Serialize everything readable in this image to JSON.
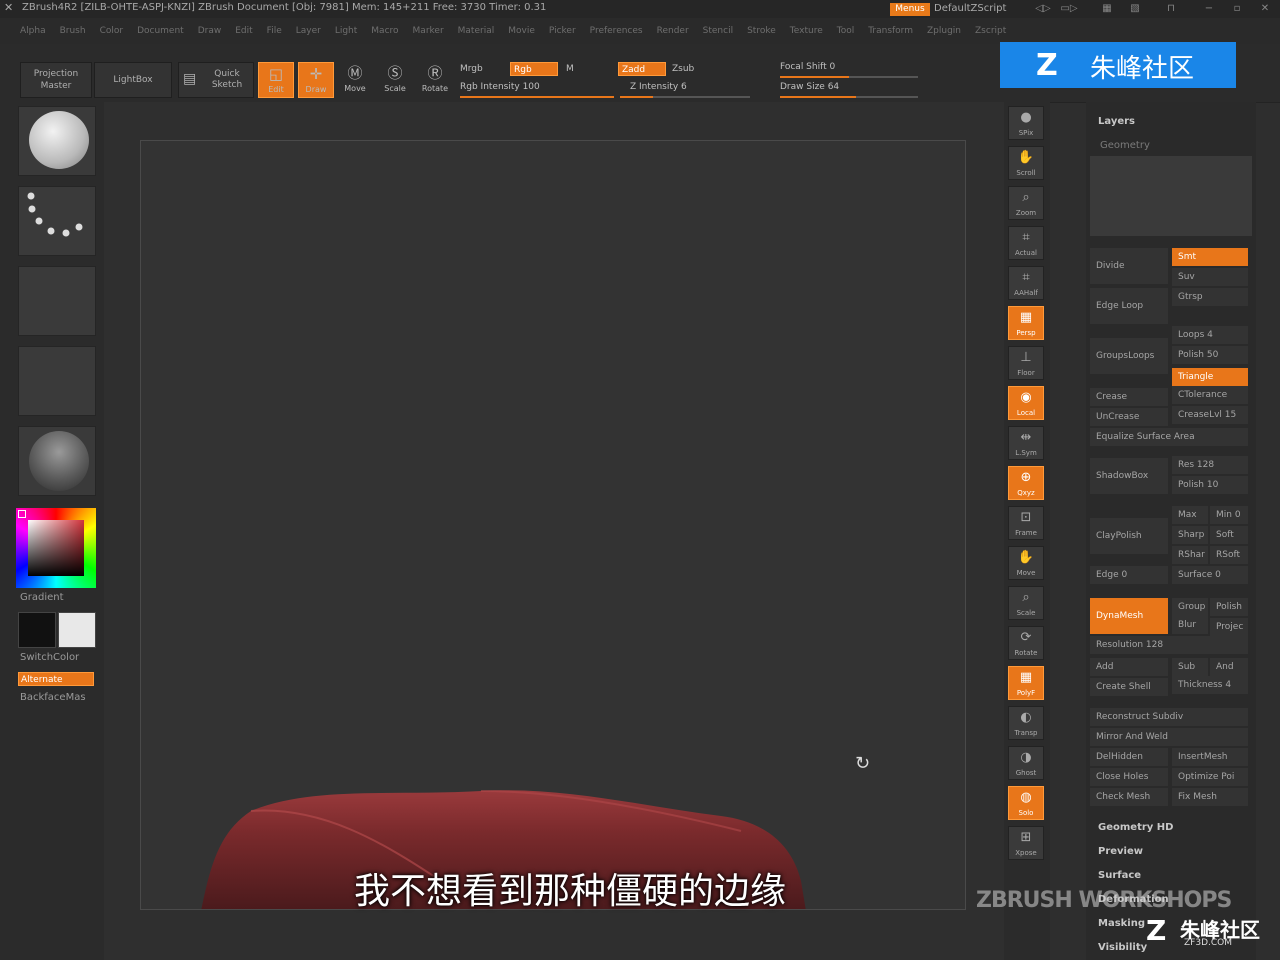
{
  "titlebar": {
    "title": "ZBrush4R2 [ZILB-OHTE-ASPJ-KNZI]   ZBrush Document   [Obj: 7981] Mem: 145+211  Free: 3730  Timer: 0.31",
    "menus_label": "Menus",
    "script_label": "DefaultZScript"
  },
  "menubar": {
    "items": [
      "Alpha",
      "Brush",
      "Color",
      "Document",
      "Draw",
      "Edit",
      "File",
      "Layer",
      "Light",
      "Macro",
      "Marker",
      "Material",
      "Movie",
      "Picker",
      "Preferences",
      "Render",
      "Stencil",
      "Stroke",
      "Texture",
      "Tool",
      "Transform",
      "Zplugin",
      "Zscript"
    ]
  },
  "shelf": {
    "projection_master": "Projection Master",
    "lightbox": "LightBox",
    "quick_sketch": "Quick Sketch",
    "edit": "Edit",
    "draw": "Draw",
    "move": "Move",
    "scale": "Scale",
    "rotate": "Rotate",
    "mrgb": "Mrgb",
    "rgb": "Rgb",
    "m": "M",
    "rgb_intensity": "Rgb Intensity 100",
    "zadd": "Zadd",
    "zsub": "Zsub",
    "z_intensity": "Z Intensity 6",
    "focal_shift": "Focal Shift 0",
    "draw_size": "Draw Size 64"
  },
  "left_panel": {
    "gradient": "Gradient",
    "switchcolor": "SwitchColor",
    "alternate": "Alternate",
    "backfacemask": "BackfaceMas"
  },
  "right_shelf": {
    "items": [
      "SPix",
      "Scroll",
      "Zoom",
      "Actual",
      "AAHalf",
      "Persp",
      "Floor",
      "Local",
      "L.Sym",
      "Qxyz",
      "Frame",
      "Move",
      "Scale",
      "Rotate",
      "PolyF",
      "Transp",
      "Ghost",
      "Solo",
      "Xpose"
    ]
  },
  "tray": {
    "layers": "Layers",
    "geometry": "Geometry",
    "divide": "Divide",
    "smt": "Smt",
    "suv": "Suv",
    "edge_loop": "Edge Loop",
    "gtrsp": "Gtrsp",
    "loops": "Loops 4",
    "grouploops": "GroupsLoops",
    "polish50": "Polish 50",
    "triangle": "Triangle",
    "crease": "Crease",
    "ctolerance": "CTolerance",
    "uncrease": "UnCrease",
    "creaselvl": "CreaseLvl 15",
    "equalize": "Equalize Surface Area",
    "shadowbox": "ShadowBox",
    "res128": "Res 128",
    "polish10": "Polish 10",
    "claypolish": "ClayPolish",
    "max": "Max",
    "min": "Min 0",
    "sharp": "Sharp",
    "soft": "Soft",
    "rshar": "RShar",
    "rsoft": "RSoft",
    "edge0": "Edge 0",
    "surface0": "Surface 0",
    "dynamesh": "DynaMesh",
    "group": "Group",
    "polish": "Polish",
    "blur": "Blur",
    "project": "Projec",
    "resolution": "Resolution 128",
    "add": "Add",
    "sub": "Sub",
    "and": "And",
    "create_shell": "Create Shell",
    "thickness": "Thickness 4",
    "reconstruct": "Reconstruct Subdiv",
    "mirror_weld": "Mirror And Weld",
    "delhidden": "DelHidden",
    "insertmesh": "InsertMesh",
    "close_holes": "Close Holes",
    "optimize": "Optimize Poi",
    "check_mesh": "Check Mesh",
    "fix_mesh": "Fix Mesh",
    "geometry_hd": "Geometry HD",
    "preview": "Preview",
    "surface": "Surface",
    "deformation": "Deformation",
    "masking": "Masking",
    "visibility": "Visibility"
  },
  "overlay": {
    "subtitle": "我不想看到那种僵硬的边缘",
    "watermark": "ZBRUSH WORKSHOPS",
    "logo_banner": "朱峰社区",
    "logo_corner": "朱峰社区",
    "logo_url": "ZF3D.COM"
  },
  "colors": {
    "accent": "#e8761a",
    "background": "#2e2e2e",
    "mesh": "#7a2a2c",
    "logo_blue": "#1a86e8"
  }
}
